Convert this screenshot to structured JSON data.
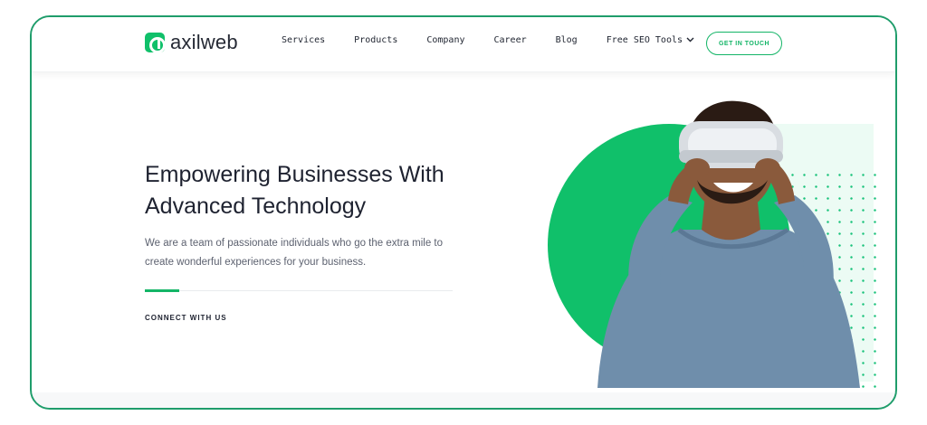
{
  "brand": {
    "name": "axilweb",
    "accent": "#10c06a"
  },
  "nav": {
    "items": [
      "Services",
      "Products",
      "Company",
      "Career",
      "Blog",
      "Free SEO Tools"
    ],
    "cta": "GET IN TOUCH"
  },
  "hero": {
    "title_line1": "Empowering Businesses With",
    "title_line2": "Advanced Technology",
    "sub_line1": "We are a team of passionate individuals who go the extra mile to",
    "sub_line2": "create wonderful experiences for your business.",
    "connect": "CONNECT WITH US"
  },
  "illustration": {
    "icon": "vr-person-image"
  }
}
